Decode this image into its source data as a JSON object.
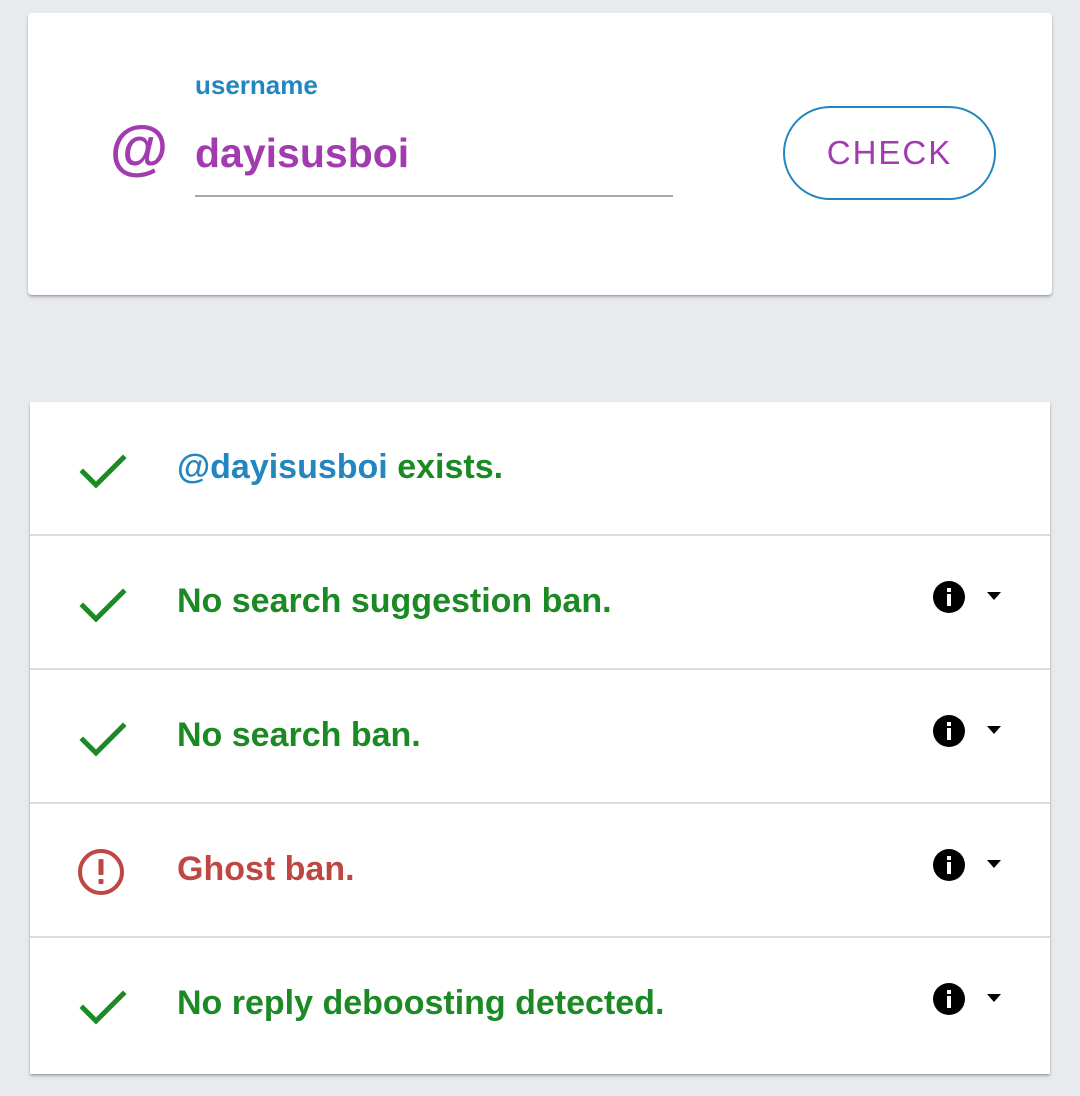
{
  "search": {
    "label": "username",
    "value": "dayisusboi",
    "at_symbol": "@",
    "button_label": "CHECK"
  },
  "results": [
    {
      "handle": "@dayisusboi",
      "text": " exists.",
      "status": "ok",
      "icon": "checkmark-icon",
      "expandable": false
    },
    {
      "handle": "",
      "text": "No search suggestion ban.",
      "status": "ok",
      "icon": "checkmark-icon",
      "expandable": true
    },
    {
      "handle": "",
      "text": "No search ban.",
      "status": "ok",
      "icon": "checkmark-icon",
      "expandable": true
    },
    {
      "handle": "",
      "text": "Ghost ban.",
      "status": "bad",
      "icon": "alert-circle-icon",
      "expandable": true
    },
    {
      "handle": "",
      "text": "No reply deboosting detected.",
      "status": "ok",
      "icon": "checkmark-icon",
      "expandable": true
    }
  ],
  "colors": {
    "accent_purple": "#a23ab0",
    "accent_blue": "#2386c0",
    "ok_green": "#1b8a25",
    "bad_red": "#be4643",
    "background": "#e8ebee"
  }
}
